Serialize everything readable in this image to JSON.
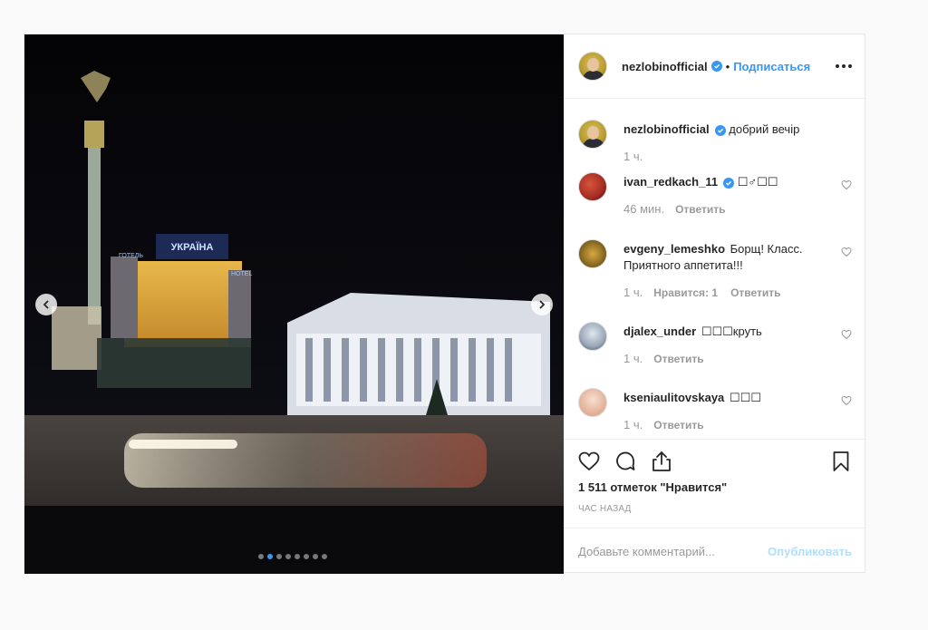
{
  "post": {
    "author": "nezlobinofficial",
    "follow_label": "Подписаться",
    "separator": "•",
    "caption": {
      "username": "nezlobinofficial",
      "text": "добрий вечір",
      "time": "1 ч."
    },
    "comments": [
      {
        "username": "ivan_redkach_11",
        "verified": true,
        "text": "☐♂☐☐",
        "time": "46 мин.",
        "likes": "",
        "reply": "Ответить"
      },
      {
        "username": "evgeny_lemeshko",
        "verified": false,
        "text": "Борщ! Класс. Приятного аппетита!!!",
        "time": "1 ч.",
        "likes": "Нравится: 1",
        "reply": "Ответить"
      },
      {
        "username": "djalex_under",
        "verified": false,
        "text": "☐☐☐круть",
        "time": "1 ч.",
        "likes": "",
        "reply": "Ответить"
      },
      {
        "username": "kseniaulitovskaya",
        "verified": false,
        "text": "☐☐☐",
        "time": "1 ч.",
        "likes": "",
        "reply": "Ответить"
      }
    ],
    "likes_text": "1 511 отметок \"Нравится\"",
    "time_ago": "ЧАС НАЗАД",
    "comment_placeholder": "Добавьте комментарий...",
    "publish_label": "Опубликовать",
    "carousel": {
      "count": 8,
      "active_index": 1
    },
    "sign_text": {
      "ukraina": "УКРАЇНА",
      "hotel_left": "ГОТЕЛЬ",
      "hotel_right": "HOTEL"
    },
    "icons": [
      "heart-icon",
      "comment-icon",
      "share-icon",
      "bookmark-icon",
      "more-options-icon",
      "verified-icon",
      "chevron-left-icon",
      "chevron-right-icon"
    ],
    "colors": {
      "link": "#3897f0",
      "publish_disabled": "#b2dffc",
      "muted": "#999999"
    }
  }
}
